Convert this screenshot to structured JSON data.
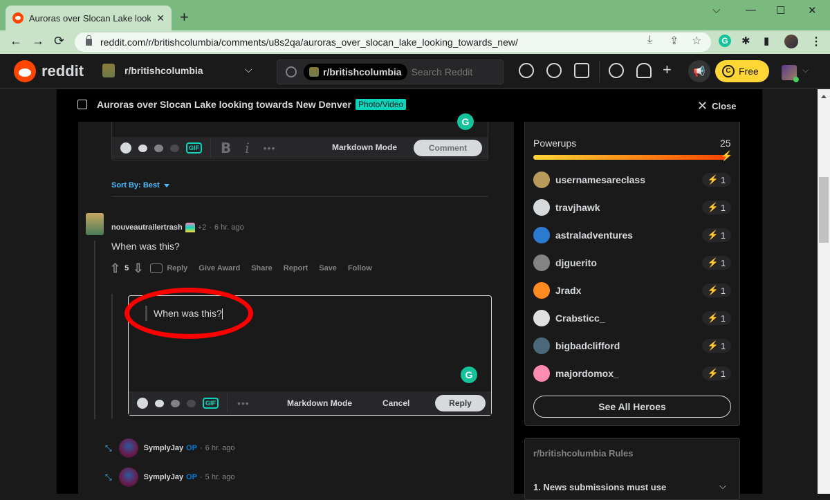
{
  "browser": {
    "tab_title": "Auroras over Slocan Lake looking towards New Denver",
    "url": "reddit.com/r/britishcolumbia/comments/u8s2qa/auroras_over_slocan_lake_looking_towards_new/",
    "new_tab": "+",
    "close_tab": "✕",
    "window_controls": {
      "tabsearch": "⌵",
      "minimize": "—",
      "maximize": "☐",
      "close": "✕"
    },
    "nav": {
      "back": "←",
      "forward": "→",
      "reload": "⟳"
    },
    "omnibox_icons": {
      "install": "⤓",
      "share": "⇪",
      "bookmark": "☆"
    },
    "extensions": {
      "grammarly": "G",
      "puzzle": "✱",
      "sidepanel": "▮",
      "menu": "⋮"
    }
  },
  "reddit_header": {
    "wordmark": "reddit",
    "subreddit": "r/britishcolumbia",
    "dropdown": "⌵",
    "search_chip": "r/britishcolumbia",
    "search_placeholder": "Search Reddit",
    "icons": [
      "popular-icon",
      "stats-icon",
      "video-icon",
      "chat-icon",
      "bell-icon",
      "plus-icon",
      "advertise-icon"
    ],
    "plus": "+",
    "free_label": "Free",
    "coin": "C",
    "user_chevron": "⌵"
  },
  "post": {
    "title": "Auroras over Slocan Lake looking towards New Denver",
    "flair": "Photo/Video",
    "close_label": "Close",
    "close_icon": "✕"
  },
  "top_editor": {
    "markdown_mode": "Markdown Mode",
    "submit": "Comment",
    "bold": "B",
    "italic": "i",
    "more": "•••",
    "gif": "GIF"
  },
  "sort": {
    "label": "Sort By: Best"
  },
  "comment": {
    "author": "nouveautrailertrash",
    "karma": "+2",
    "time": "6 hr. ago",
    "body": "When was this?",
    "votes": "5",
    "actions": [
      "Reply",
      "Give Award",
      "Share",
      "Report",
      "Save",
      "Follow"
    ]
  },
  "reply_editor": {
    "text": "When was this?",
    "markdown_mode": "Markdown Mode",
    "cancel": "Cancel",
    "submit": "Reply",
    "more": "•••",
    "gif": "GIF"
  },
  "child_comments": [
    {
      "author": "SymplyJay",
      "op": "OP",
      "time": "6 hr. ago"
    },
    {
      "author": "SymplyJay",
      "op": "OP",
      "time": "5 hr. ago"
    }
  ],
  "powerups": {
    "title": "Powerups",
    "count": "25",
    "progress": 1.0,
    "heroes": [
      {
        "name": "usernamesareclass",
        "count": "1",
        "color": "#b89a5a"
      },
      {
        "name": "travjhawk",
        "count": "1",
        "color": "#d7dadc"
      },
      {
        "name": "astraladventures",
        "count": "1",
        "color": "#2a7ad0"
      },
      {
        "name": "djguerito",
        "count": "1",
        "color": "#818384"
      },
      {
        "name": "Jradx",
        "count": "1",
        "color": "#ff8a20"
      },
      {
        "name": "Crabsticc_",
        "count": "1",
        "color": "#e0e0e0"
      },
      {
        "name": "bigbadclifford",
        "count": "1",
        "color": "#4a6a7a"
      },
      {
        "name": "majordomox_",
        "count": "1",
        "color": "#ff8ab4"
      }
    ],
    "see_all": "See All Heroes"
  },
  "rules": {
    "title": "r/britishcolumbia Rules",
    "items": [
      "1. News submissions must use"
    ],
    "chevron": "⌵"
  },
  "colors": {
    "accent": "#ff4500",
    "link": "#4fbcff",
    "flair": "#0dd3bb",
    "premium": "#ffd635",
    "annotation": "#ff0000"
  }
}
